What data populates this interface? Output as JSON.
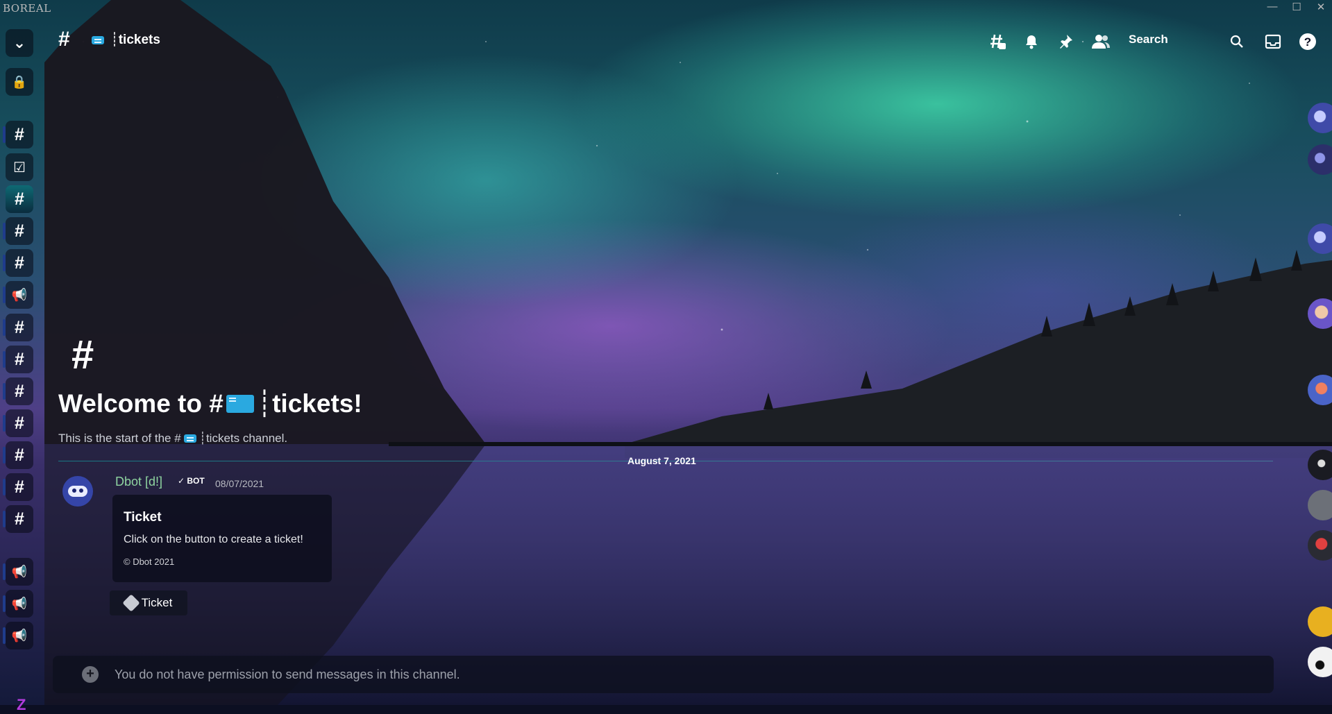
{
  "app": {
    "brand": "BOREAL"
  },
  "window_controls": {
    "minimize": "—",
    "maximize": "☐",
    "close": "✕"
  },
  "colors": {
    "accent": "#1f3c8c",
    "selected_rail": "#0e6a74",
    "bot_name": "#8fd4a0"
  },
  "header": {
    "channel_hash": "#",
    "channel_name": "┊tickets",
    "search_label": "Search",
    "icons": [
      "threads-icon",
      "bell-icon",
      "pin-icon",
      "members-icon",
      "search-icon",
      "inbox-icon",
      "help-icon"
    ]
  },
  "rail": {
    "collapse_icon": "⌄",
    "lock_icon": "🔒",
    "items": [
      "#",
      "☑",
      "#",
      "#",
      "#",
      "📢",
      "#",
      "#",
      "#",
      "#",
      "#",
      "#",
      "#",
      "📢",
      "📢",
      "📢"
    ],
    "footer_logo": "Z"
  },
  "welcome": {
    "hash": "#",
    "title_prefix": "Welcome to #",
    "title_suffix": "┊tickets!",
    "sub_prefix": "This is the start of the #",
    "sub_suffix": "┊tickets channel."
  },
  "divider": {
    "date": "August 7, 2021"
  },
  "message": {
    "author": "Dbot [d!]",
    "bot_tag": "✓ BOT",
    "timestamp": "08/07/2021",
    "embed": {
      "title": "Ticket",
      "description": "Click on the button to create a ticket!",
      "footer": "© Dbot 2021"
    },
    "button_label": "Ticket"
  },
  "composer": {
    "plus": "+",
    "placeholder": "You do not have permission to send messages in this channel."
  }
}
